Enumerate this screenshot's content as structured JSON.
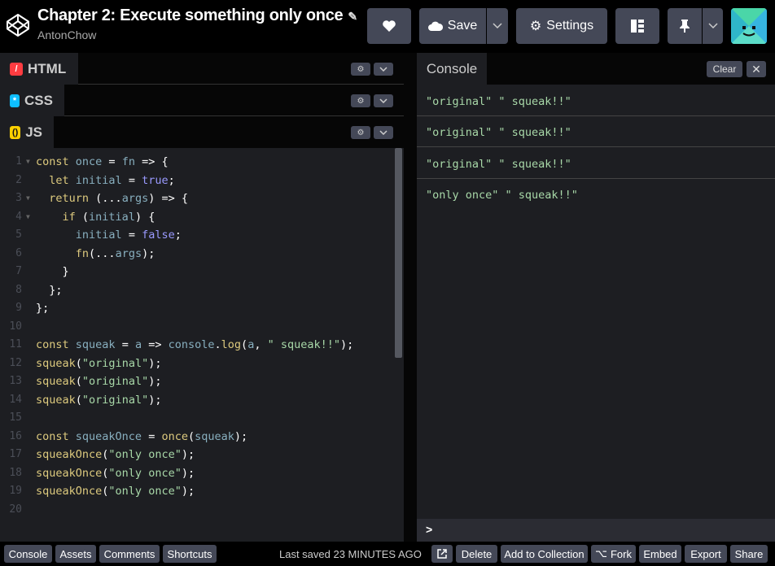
{
  "header": {
    "title": "Chapter 2: Execute something only once",
    "author": "AntonChow",
    "save_label": "Save",
    "settings_label": "Settings"
  },
  "panels": {
    "html_label": "HTML",
    "css_label": "CSS",
    "js_label": "JS"
  },
  "code_lines": [
    "const once = fn => {",
    "  let initial = true;",
    "  return (...args) => {",
    "    if (initial) {",
    "      initial = false;",
    "      fn(...args);",
    "    }",
    "  };",
    "};",
    "",
    "const squeak = a => console.log(a, \" squeak!!\");",
    "squeak(\"original\");",
    "squeak(\"original\");",
    "squeak(\"original\");",
    "",
    "const squeakOnce = once(squeak);",
    "squeakOnce(\"only once\");",
    "squeakOnce(\"only once\");",
    "squeakOnce(\"only once\");",
    ""
  ],
  "line_numbers": [
    "1",
    "2",
    "3",
    "4",
    "5",
    "6",
    "7",
    "8",
    "9",
    "10",
    "11",
    "12",
    "13",
    "14",
    "15",
    "16",
    "17",
    "18",
    "19",
    "20"
  ],
  "console": {
    "tab_label": "Console",
    "clear_label": "Clear",
    "close_label": "✕",
    "prompt": ">",
    "entries": [
      "\"original\" \" squeak!!\"",
      "\"original\" \" squeak!!\"",
      "\"original\" \" squeak!!\"",
      "\"only once\" \" squeak!!\""
    ]
  },
  "footer": {
    "console": "Console",
    "assets": "Assets",
    "comments": "Comments",
    "shortcuts": "Shortcuts",
    "last_saved": "Last saved 23 MINUTES AGO",
    "delete": "Delete",
    "add_to_collection": "Add to Collection",
    "fork": "Fork",
    "embed": "Embed",
    "export": "Export",
    "share": "Share"
  },
  "colors": {
    "html_badge": "#ff3c41",
    "css_badge": "#0ebeff",
    "js_badge": "#fcd000",
    "string": "#a8d8a8",
    "keyword": "#ddca7e",
    "variable": "#88afbf"
  },
  "icons": {
    "logo": "codepen-logo",
    "heart": "heart-icon",
    "cloud": "cloud-icon",
    "gear": "gear-icon",
    "layout": "layout-icon",
    "pin": "pin-icon",
    "chevron": "chevron-down-icon"
  }
}
